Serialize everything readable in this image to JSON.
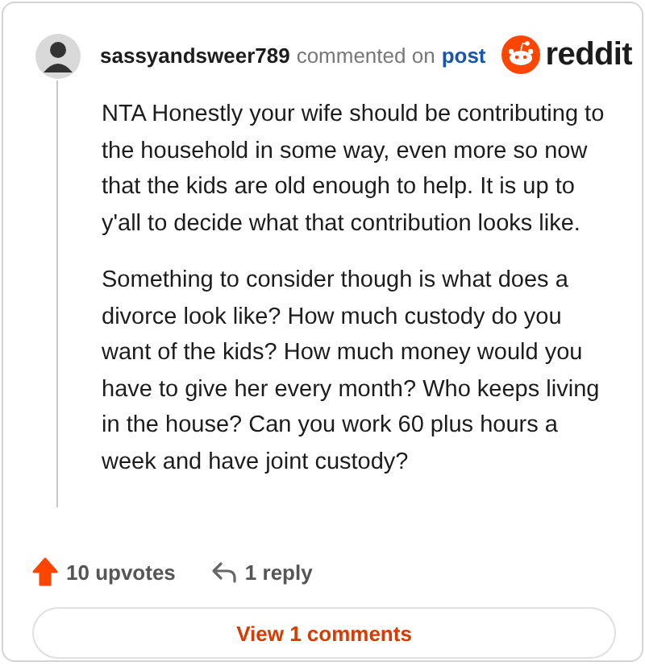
{
  "comment": {
    "author": "sassyandsweer789",
    "action": "commented on",
    "link": "post",
    "paragraphs": [
      "NTA Honestly your wife should be contributing to the household in some way, even more so now that the kids are old enough to help. It is up to y'all to decide what that contribution looks like.",
      "Something to consider though is what does a divorce look like? How much custody do you want of the kids? How much money would you have to give her every month? Who keeps living in the house? Can you work 60 plus hours a week and have joint custody?"
    ],
    "upvoted": true,
    "upvotes": "10 upvotes",
    "replies": "1 reply"
  },
  "brand": {
    "name": "reddit"
  },
  "view_button": "View 1 comments"
}
